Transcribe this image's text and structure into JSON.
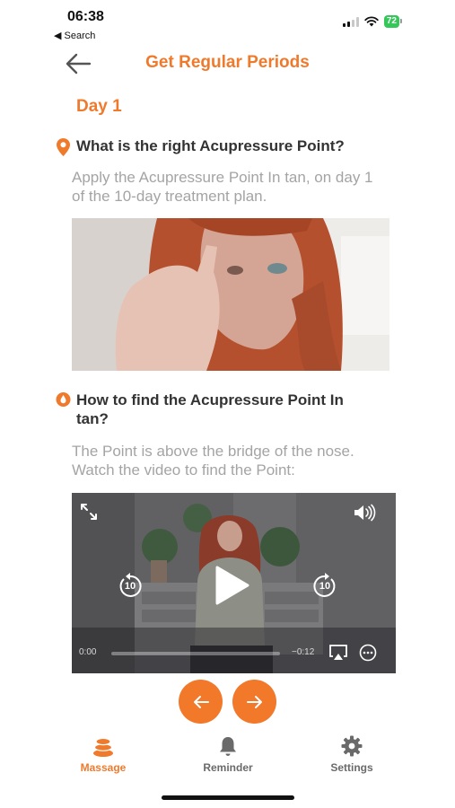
{
  "status_bar": {
    "time": "06:38",
    "back_app": "◀ Search",
    "battery": "72"
  },
  "header": {
    "title": "Get Regular Periods",
    "back_icon": "arrow-left-icon"
  },
  "day_label": "Day 1",
  "sections": [
    {
      "icon": "map-pin-icon",
      "heading": "What is the right Acupressure Point?",
      "text": "Apply the Acupressure Point In tan, on day 1 of the 10-day treatment plan."
    },
    {
      "icon": "drop-icon",
      "heading": "How to find the Acupressure Point In tan?",
      "text": "The Point is above the bridge of the nose. Watch the video to find the Point:"
    }
  ],
  "video": {
    "current_time": "0:00",
    "remaining_time": "−0:12",
    "skip_seconds": "10",
    "progress": 0
  },
  "tabs": [
    {
      "label": "Massage",
      "icon": "massage-stones-icon",
      "active": true
    },
    {
      "label": "Reminder",
      "icon": "bell-icon",
      "active": false
    },
    {
      "label": "Settings",
      "icon": "gear-icon",
      "active": false
    }
  ],
  "colors": {
    "accent": "#f07a2c",
    "nav_button": "#f2782a",
    "muted_text": "#a4a4a4",
    "battery": "#35c759"
  }
}
